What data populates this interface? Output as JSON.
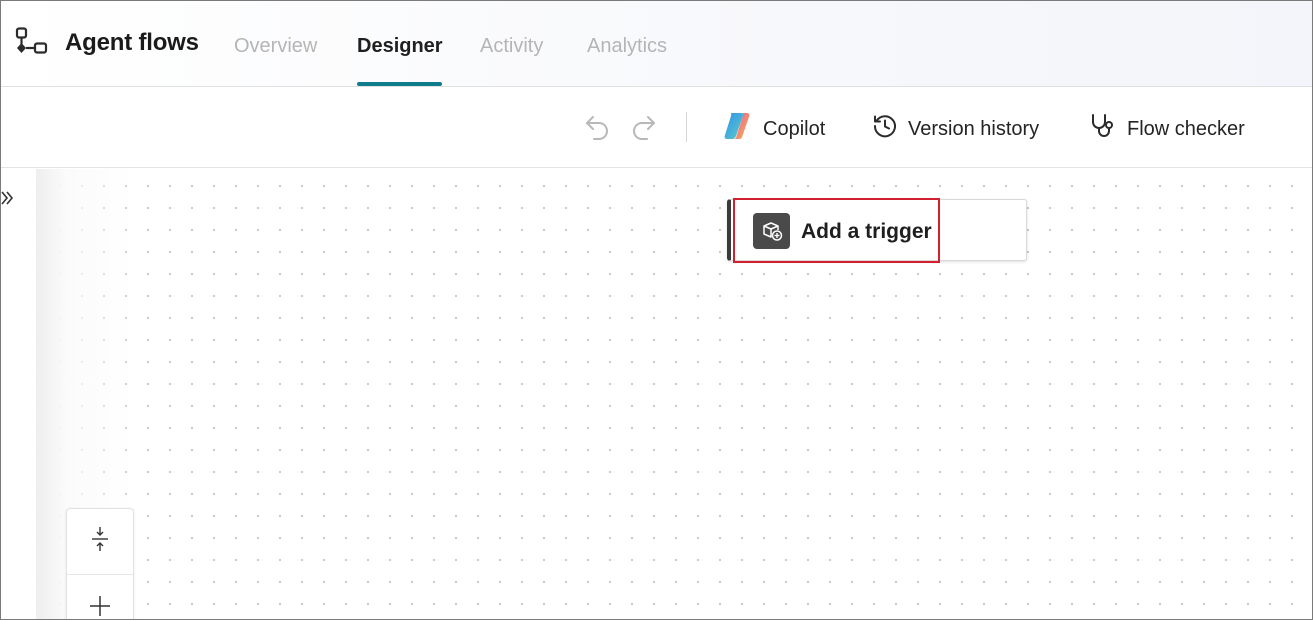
{
  "header": {
    "app_title": "Agent flows",
    "app_icon": "flow-icon",
    "tabs": [
      {
        "label": "Overview",
        "active": false
      },
      {
        "label": "Designer",
        "active": true
      },
      {
        "label": "Activity",
        "active": false
      },
      {
        "label": "Analytics",
        "active": false
      }
    ],
    "active_tab_color": "#0f7c8c"
  },
  "toolbar": {
    "undo_icon": "undo-icon",
    "redo_icon": "redo-icon",
    "copilot_label": "Copilot",
    "version_history_label": "Version history",
    "flow_checker_label": "Flow checker"
  },
  "canvas": {
    "trigger_label": "Add a trigger",
    "trigger_icon": "trigger-add-icon",
    "highlight_color": "#d2202f",
    "zoom_fit_icon": "fit-view-icon",
    "zoom_in_icon": "zoom-in-icon",
    "expand_icon": "expand-panel-icon"
  }
}
